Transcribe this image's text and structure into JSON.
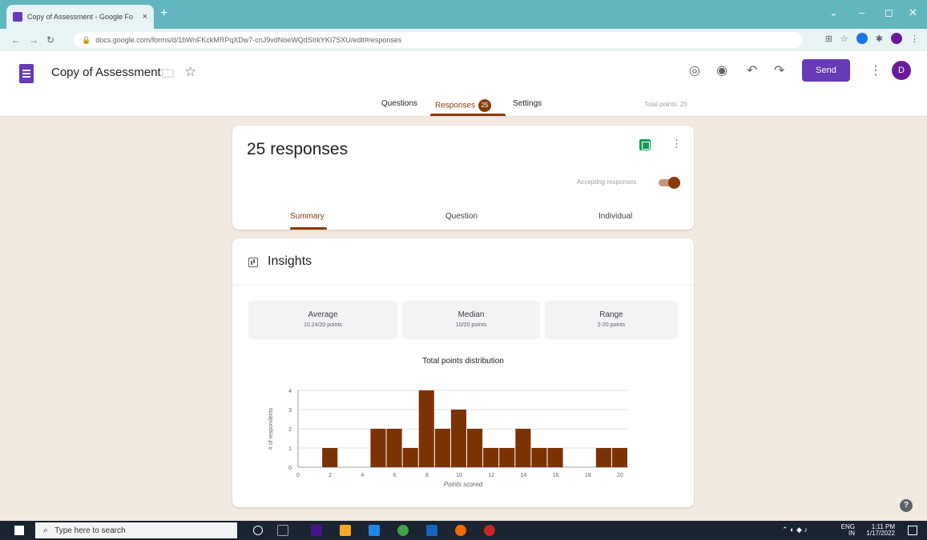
{
  "browser": {
    "tab_title": "Copy of Assessment - Google Fo",
    "tab_close": "×",
    "new_tab": "+",
    "url": "docs.google.com/forms/d/1bWnFKckMRPqXDw7-cnJ9vdNoeWQdSIrkYKI7SXU/edit#responses"
  },
  "form": {
    "title": "Copy of Assessment",
    "send_label": "Send",
    "avatar_letter": "D",
    "tabs": {
      "questions": "Questions",
      "responses": "Responses",
      "responses_count": "25",
      "settings": "Settings"
    },
    "total_points": "Total points: 20"
  },
  "summary": {
    "title": "25 responses",
    "accepting_label": "Accepting responses",
    "tabs": {
      "summary": "Summary",
      "question": "Question",
      "individual": "Individual"
    }
  },
  "insights": {
    "title": "Insights",
    "average": {
      "label": "Average",
      "value": "10.24/20 points"
    },
    "median": {
      "label": "Median",
      "value": "10/20 points"
    },
    "range": {
      "label": "Range",
      "value": "2-20 points"
    },
    "chart_title": "Total points distribution"
  },
  "chart_data": {
    "type": "bar",
    "title": "Total points distribution",
    "xlabel": "Points scored",
    "ylabel": "# of respondents",
    "x": [
      2,
      5,
      6,
      7,
      8,
      9,
      10,
      11,
      12,
      13,
      14,
      15,
      16,
      19,
      20
    ],
    "values": [
      1,
      2,
      2,
      1,
      4,
      2,
      3,
      2,
      1,
      1,
      2,
      1,
      1,
      1,
      1
    ],
    "xlim": [
      0,
      20.5
    ],
    "ylim": [
      0,
      4
    ],
    "x_ticks": [
      "0",
      "2",
      "4",
      "6",
      "8",
      "10",
      "12",
      "14",
      "16",
      "18",
      "20"
    ],
    "y_ticks": [
      "0",
      "1",
      "2",
      "3",
      "4"
    ],
    "bar_color": "#7b3306",
    "grid": true
  },
  "taskbar": {
    "search_placeholder": "Type here to search",
    "lang": "ENG",
    "lang2": "IN",
    "time": "1:11 PM",
    "date": "1/17/2022"
  },
  "colors": {
    "accent": "#8b3a0c",
    "purple": "#673ab7",
    "page_bg": "#f2e9e1"
  }
}
